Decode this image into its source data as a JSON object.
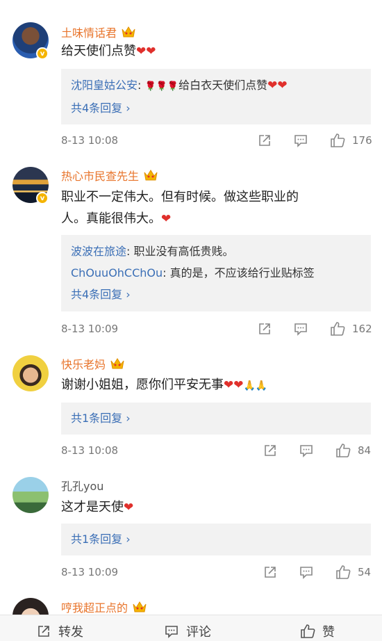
{
  "comments": [
    {
      "user": "土味情话君",
      "text": "给天使们点赞",
      "replies": [
        {
          "name": "沈阳皇姑公安",
          "text": "给白衣天使们点赞"
        }
      ],
      "more_replies": "共4条回复 ›",
      "time": "8-13 10:08",
      "likes": "176"
    },
    {
      "user": "热心市民查先生",
      "text_line1": "职业不一定伟大。但有时候。做这些职业的",
      "text_line2": "人。真能很伟大。",
      "replies": [
        {
          "name": "波波在旅途",
          "text": "职业没有高低贵贱。"
        },
        {
          "name": "ChOuuOhCChOu",
          "text": "真的是，不应该给行业贴标签"
        }
      ],
      "more_replies": "共4条回复 ›",
      "time": "8-13 10:09",
      "likes": "162"
    },
    {
      "user": "快乐老妈",
      "text": "谢谢小姐姐，愿你们平安无事",
      "more_replies": "共1条回复 ›",
      "time": "8-13 10:08",
      "likes": "84"
    },
    {
      "user": "孔孔you",
      "text": "这才是天使",
      "more_replies": "共1条回复 ›",
      "time": "8-13 10:09",
      "likes": "54"
    },
    {
      "user": "哼我超正点的"
    }
  ],
  "bottom_bar": {
    "repost": "转发",
    "comment": "评论",
    "like": "赞"
  },
  "colors": {
    "username": "#e8742b",
    "reply_name": "#3b6fb6",
    "heart": "#e0302c"
  },
  "icons": [
    "share-icon",
    "comment-icon",
    "thumbs-up-icon",
    "crown-icon",
    "verified-badge-icon"
  ]
}
